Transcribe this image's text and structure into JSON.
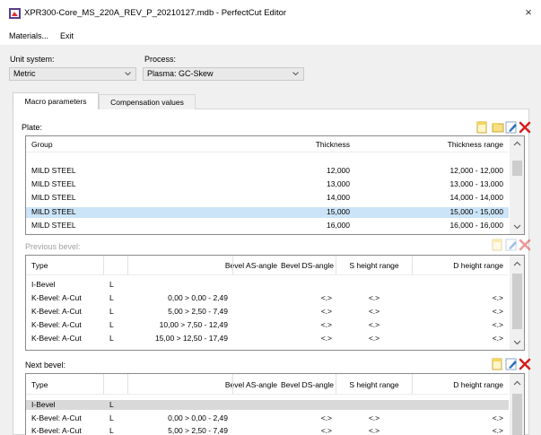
{
  "window": {
    "title": "XPR300-Core_MS_220A_REV_P_20210127.mdb - PerfectCut Editor",
    "close_glyph": "×"
  },
  "menu": {
    "items": [
      "Materials...",
      "Exit"
    ]
  },
  "unit_system": {
    "label": "Unit system:",
    "value": "Metric"
  },
  "process": {
    "label": "Process:",
    "value": "Plasma: GC-Skew"
  },
  "tabs": [
    {
      "label": "Macro parameters",
      "active": true
    },
    {
      "label": "Compensation values",
      "active": false
    }
  ],
  "plate": {
    "label": "Plate:",
    "columns": [
      "Group",
      "Thickness",
      "Thickness range"
    ],
    "rows": [
      [
        "MILD STEEL",
        "12,000",
        "12,000 - 12,000"
      ],
      [
        "MILD STEEL",
        "13,000",
        "13,000 - 13,000"
      ],
      [
        "MILD STEEL",
        "14,000",
        "14,000 - 14,000"
      ],
      [
        "MILD STEEL",
        "15,000",
        "15,000 - 15,000"
      ],
      [
        "MILD STEEL",
        "16,000",
        "16,000 - 16,000"
      ]
    ],
    "selected_row": 3,
    "buttons": [
      "new-document-icon",
      "open-folder-icon",
      "edit-icon",
      "delete-icon"
    ]
  },
  "previous_bevel": {
    "label": "Previous bevel:",
    "columns": [
      "Type",
      "",
      "Bevel AS-angle",
      "Bevel DS-angle",
      "S height range",
      "D height range"
    ],
    "rows": [
      [
        "I-Bevel",
        "L",
        "",
        "",
        "",
        ""
      ],
      [
        "K-Bevel: A-Cut",
        "L",
        "0,00 > 0,00 - 2,49",
        "<.>",
        "<.>",
        "<.>"
      ],
      [
        "K-Bevel: A-Cut",
        "L",
        "5,00 > 2,50 - 7,49",
        "<.>",
        "<.>",
        "<.>"
      ],
      [
        "K-Bevel: A-Cut",
        "L",
        "10,00 > 7,50 - 12,49",
        "<.>",
        "<.>",
        "<.>"
      ],
      [
        "K-Bevel: A-Cut",
        "L",
        "15,00 > 12,50 - 17,49",
        "<.>",
        "<.>",
        "<.>"
      ]
    ],
    "buttons": [
      "new-document-icon",
      "edit-icon",
      "delete-icon"
    ]
  },
  "next_bevel": {
    "label": "Next bevel:",
    "columns": [
      "Type",
      "",
      "Bevel AS-angle",
      "Bevel DS-angle",
      "S height range",
      "D height range"
    ],
    "rows": [
      [
        "I-Bevel",
        "L",
        "",
        "",
        "",
        ""
      ],
      [
        "K-Bevel: A-Cut",
        "L",
        "0,00 > 0,00 - 2,49",
        "<.>",
        "<.>",
        "<.>"
      ],
      [
        "K-Bevel: A-Cut",
        "L",
        "5,00 > 2,50 - 7,49",
        "<.>",
        "<.>",
        "<.>"
      ]
    ],
    "buttons": [
      "new-document-icon",
      "edit-icon",
      "delete-icon"
    ]
  },
  "colors": {
    "selection": "#cce4f7",
    "delete_red": "#d42020",
    "edit_blue": "#2f6fc0",
    "icon_yellow": "#f5d45a"
  }
}
